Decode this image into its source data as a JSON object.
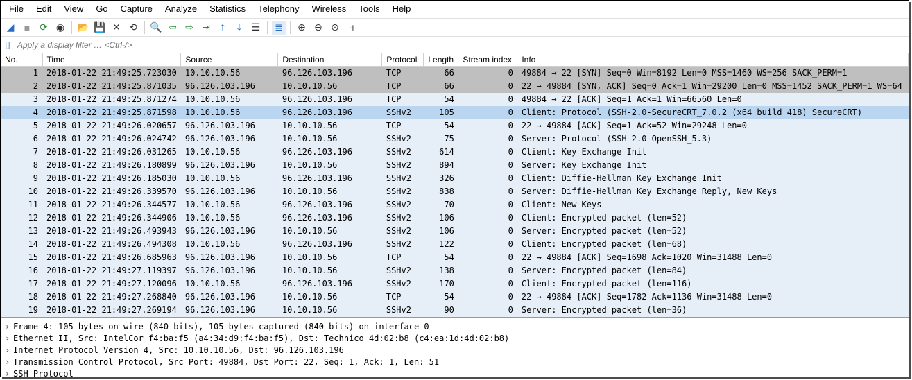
{
  "menubar": [
    "File",
    "Edit",
    "View",
    "Go",
    "Capture",
    "Analyze",
    "Statistics",
    "Telephony",
    "Wireless",
    "Tools",
    "Help"
  ],
  "filter": {
    "placeholder": "Apply a display filter … <Ctrl-/>"
  },
  "columns": [
    "No.",
    "Time",
    "Source",
    "Destination",
    "Protocol",
    "Length",
    "Stream index",
    "Info"
  ],
  "packets": [
    {
      "no": 1,
      "time": "2018-01-22 21:49:25.723030",
      "src": "10.10.10.56",
      "dst": "96.126.103.196",
      "proto": "TCP",
      "len": 66,
      "idx": 0,
      "info": "49884 → 22 [SYN] Seq=0 Win=8192 Len=0 MSS=1460 WS=256 SACK_PERM=1",
      "cls": "grey"
    },
    {
      "no": 2,
      "time": "2018-01-22 21:49:25.871035",
      "src": "96.126.103.196",
      "dst": "10.10.10.56",
      "proto": "TCP",
      "len": 66,
      "idx": 0,
      "info": "22 → 49884 [SYN, ACK] Seq=0 Ack=1 Win=29200 Len=0 MSS=1452 SACK_PERM=1 WS=64",
      "cls": "grey"
    },
    {
      "no": 3,
      "time": "2018-01-22 21:49:25.871274",
      "src": "10.10.10.56",
      "dst": "96.126.103.196",
      "proto": "TCP",
      "len": 54,
      "idx": 0,
      "info": "49884 → 22 [ACK] Seq=1 Ack=1 Win=66560 Len=0",
      "cls": "lightblue"
    },
    {
      "no": 4,
      "time": "2018-01-22 21:49:25.871598",
      "src": "10.10.10.56",
      "dst": "96.126.103.196",
      "proto": "SSHv2",
      "len": 105,
      "idx": 0,
      "info": "Client: Protocol (SSH-2.0-SecureCRT_7.0.2 (x64 build 418) SecureCRT)",
      "cls": "selected"
    },
    {
      "no": 5,
      "time": "2018-01-22 21:49:26.020657",
      "src": "96.126.103.196",
      "dst": "10.10.10.56",
      "proto": "TCP",
      "len": 54,
      "idx": 0,
      "info": "22 → 49884 [ACK] Seq=1 Ack=52 Win=29248 Len=0",
      "cls": "lightblue"
    },
    {
      "no": 6,
      "time": "2018-01-22 21:49:26.024742",
      "src": "96.126.103.196",
      "dst": "10.10.10.56",
      "proto": "SSHv2",
      "len": 75,
      "idx": 0,
      "info": "Server: Protocol (SSH-2.0-OpenSSH_5.3)",
      "cls": "lightblue"
    },
    {
      "no": 7,
      "time": "2018-01-22 21:49:26.031265",
      "src": "10.10.10.56",
      "dst": "96.126.103.196",
      "proto": "SSHv2",
      "len": 614,
      "idx": 0,
      "info": "Client: Key Exchange Init",
      "cls": "lightblue"
    },
    {
      "no": 8,
      "time": "2018-01-22 21:49:26.180899",
      "src": "96.126.103.196",
      "dst": "10.10.10.56",
      "proto": "SSHv2",
      "len": 894,
      "idx": 0,
      "info": "Server: Key Exchange Init",
      "cls": "lightblue"
    },
    {
      "no": 9,
      "time": "2018-01-22 21:49:26.185030",
      "src": "10.10.10.56",
      "dst": "96.126.103.196",
      "proto": "SSHv2",
      "len": 326,
      "idx": 0,
      "info": "Client: Diffie-Hellman Key Exchange Init",
      "cls": "lightblue"
    },
    {
      "no": 10,
      "time": "2018-01-22 21:49:26.339570",
      "src": "96.126.103.196",
      "dst": "10.10.10.56",
      "proto": "SSHv2",
      "len": 838,
      "idx": 0,
      "info": "Server: Diffie-Hellman Key Exchange Reply, New Keys",
      "cls": "lightblue"
    },
    {
      "no": 11,
      "time": "2018-01-22 21:49:26.344577",
      "src": "10.10.10.56",
      "dst": "96.126.103.196",
      "proto": "SSHv2",
      "len": 70,
      "idx": 0,
      "info": "Client: New Keys",
      "cls": "lightblue"
    },
    {
      "no": 12,
      "time": "2018-01-22 21:49:26.344906",
      "src": "10.10.10.56",
      "dst": "96.126.103.196",
      "proto": "SSHv2",
      "len": 106,
      "idx": 0,
      "info": "Client: Encrypted packet (len=52)",
      "cls": "lightblue"
    },
    {
      "no": 13,
      "time": "2018-01-22 21:49:26.493943",
      "src": "96.126.103.196",
      "dst": "10.10.10.56",
      "proto": "SSHv2",
      "len": 106,
      "idx": 0,
      "info": "Server: Encrypted packet (len=52)",
      "cls": "lightblue"
    },
    {
      "no": 14,
      "time": "2018-01-22 21:49:26.494308",
      "src": "10.10.10.56",
      "dst": "96.126.103.196",
      "proto": "SSHv2",
      "len": 122,
      "idx": 0,
      "info": "Client: Encrypted packet (len=68)",
      "cls": "lightblue"
    },
    {
      "no": 15,
      "time": "2018-01-22 21:49:26.685963",
      "src": "96.126.103.196",
      "dst": "10.10.10.56",
      "proto": "TCP",
      "len": 54,
      "idx": 0,
      "info": "22 → 49884 [ACK] Seq=1698 Ack=1020 Win=31488 Len=0",
      "cls": "lightblue"
    },
    {
      "no": 16,
      "time": "2018-01-22 21:49:27.119397",
      "src": "96.126.103.196",
      "dst": "10.10.10.56",
      "proto": "SSHv2",
      "len": 138,
      "idx": 0,
      "info": "Server: Encrypted packet (len=84)",
      "cls": "lightblue"
    },
    {
      "no": 17,
      "time": "2018-01-22 21:49:27.120096",
      "src": "10.10.10.56",
      "dst": "96.126.103.196",
      "proto": "SSHv2",
      "len": 170,
      "idx": 0,
      "info": "Client: Encrypted packet (len=116)",
      "cls": "lightblue"
    },
    {
      "no": 18,
      "time": "2018-01-22 21:49:27.268840",
      "src": "96.126.103.196",
      "dst": "10.10.10.56",
      "proto": "TCP",
      "len": 54,
      "idx": 0,
      "info": "22 → 49884 [ACK] Seq=1782 Ack=1136 Win=31488 Len=0",
      "cls": "lightblue"
    },
    {
      "no": 19,
      "time": "2018-01-22 21:49:27.269194",
      "src": "96.126.103.196",
      "dst": "10.10.10.56",
      "proto": "SSHv2",
      "len": 90,
      "idx": 0,
      "info": "Server: Encrypted packet (len=36)",
      "cls": "lightblue"
    }
  ],
  "details": [
    "Frame 4: 105 bytes on wire (840 bits), 105 bytes captured (840 bits) on interface 0",
    "Ethernet II, Src: IntelCor_f4:ba:f5 (a4:34:d9:f4:ba:f5), Dst: Technico_4d:02:b8 (c4:ea:1d:4d:02:b8)",
    "Internet Protocol Version 4, Src: 10.10.10.56, Dst: 96.126.103.196",
    "Transmission Control Protocol, Src Port: 49884, Dst Port: 22, Seq: 1, Ack: 1, Len: 51",
    "SSH Protocol"
  ]
}
